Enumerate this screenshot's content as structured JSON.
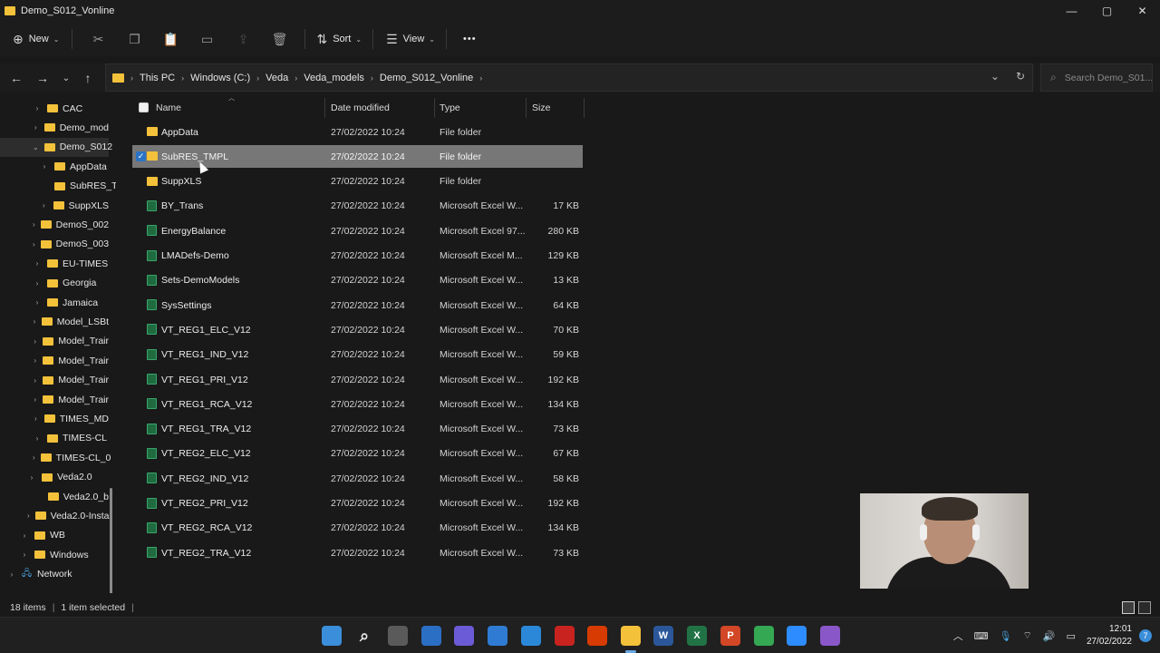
{
  "window": {
    "title": "Demo_S012_Vonline",
    "minimize": "—",
    "maximize": "▢",
    "close": "✕"
  },
  "commandbar": {
    "new_label": "New",
    "sort_label": "Sort",
    "view_label": "View",
    "more_label": "•••"
  },
  "address": {
    "crumbs": [
      "This PC",
      "Windows (C:)",
      "Veda",
      "Veda_models",
      "Demo_S012_Vonline"
    ],
    "search_placeholder": "Search Demo_S01..."
  },
  "sidebar": {
    "items": [
      {
        "label": "CAC",
        "expandable": true
      },
      {
        "label": "Demo_mod",
        "expandable": true
      },
      {
        "label": "Demo_S012",
        "expandable": true,
        "expanded": true,
        "selected": true
      },
      {
        "label": "AppData",
        "expandable": true
      },
      {
        "label": "SubRES_TI",
        "expandable": false
      },
      {
        "label": "SuppXLS",
        "expandable": true
      },
      {
        "label": "DemoS_002",
        "expandable": true
      },
      {
        "label": "DemoS_003",
        "expandable": true
      },
      {
        "label": "EU-TIMES",
        "expandable": true
      },
      {
        "label": "Georgia",
        "expandable": true
      },
      {
        "label": "Jamaica",
        "expandable": true
      },
      {
        "label": "Model_LSBt",
        "expandable": true
      },
      {
        "label": "Model_Trair",
        "expandable": true
      },
      {
        "label": "Model_Trair",
        "expandable": true
      },
      {
        "label": "Model_Trair",
        "expandable": true
      },
      {
        "label": "Model_Trair",
        "expandable": true
      },
      {
        "label": "TIMES_MD",
        "expandable": true
      },
      {
        "label": "TIMES-CL",
        "expandable": true
      },
      {
        "label": "TIMES-CL_0",
        "expandable": true
      },
      {
        "label": "Veda2.0",
        "expandable": true
      },
      {
        "label": "Veda2.0_b",
        "expandable": false
      },
      {
        "label": "Veda2.0-Insta",
        "expandable": true
      },
      {
        "label": "WB",
        "expandable": true
      },
      {
        "label": "Windows",
        "expandable": true
      },
      {
        "label": "Network",
        "expandable": true
      }
    ]
  },
  "columns": {
    "name": "Name",
    "date": "Date modified",
    "type": "Type",
    "size": "Size"
  },
  "files": [
    {
      "name": "AppData",
      "date": "27/02/2022 10:24",
      "type": "File folder",
      "size": "",
      "kind": "folder"
    },
    {
      "name": "SubRES_TMPL",
      "date": "27/02/2022 10:24",
      "type": "File folder",
      "size": "",
      "kind": "folder",
      "selected": true
    },
    {
      "name": "SuppXLS",
      "date": "27/02/2022 10:24",
      "type": "File folder",
      "size": "",
      "kind": "folder"
    },
    {
      "name": "BY_Trans",
      "date": "27/02/2022 10:24",
      "type": "Microsoft Excel W...",
      "size": "17 KB",
      "kind": "excel"
    },
    {
      "name": "EnergyBalance",
      "date": "27/02/2022 10:24",
      "type": "Microsoft Excel 97...",
      "size": "280 KB",
      "kind": "excel"
    },
    {
      "name": "LMADefs-Demo",
      "date": "27/02/2022 10:24",
      "type": "Microsoft Excel M...",
      "size": "129 KB",
      "kind": "excel"
    },
    {
      "name": "Sets-DemoModels",
      "date": "27/02/2022 10:24",
      "type": "Microsoft Excel W...",
      "size": "13 KB",
      "kind": "excel"
    },
    {
      "name": "SysSettings",
      "date": "27/02/2022 10:24",
      "type": "Microsoft Excel W...",
      "size": "64 KB",
      "kind": "excel"
    },
    {
      "name": "VT_REG1_ELC_V12",
      "date": "27/02/2022 10:24",
      "type": "Microsoft Excel W...",
      "size": "70 KB",
      "kind": "excel"
    },
    {
      "name": "VT_REG1_IND_V12",
      "date": "27/02/2022 10:24",
      "type": "Microsoft Excel W...",
      "size": "59 KB",
      "kind": "excel"
    },
    {
      "name": "VT_REG1_PRI_V12",
      "date": "27/02/2022 10:24",
      "type": "Microsoft Excel W...",
      "size": "192 KB",
      "kind": "excel"
    },
    {
      "name": "VT_REG1_RCA_V12",
      "date": "27/02/2022 10:24",
      "type": "Microsoft Excel W...",
      "size": "134 KB",
      "kind": "excel"
    },
    {
      "name": "VT_REG1_TRA_V12",
      "date": "27/02/2022 10:24",
      "type": "Microsoft Excel W...",
      "size": "73 KB",
      "kind": "excel"
    },
    {
      "name": "VT_REG2_ELC_V12",
      "date": "27/02/2022 10:24",
      "type": "Microsoft Excel W...",
      "size": "67 KB",
      "kind": "excel"
    },
    {
      "name": "VT_REG2_IND_V12",
      "date": "27/02/2022 10:24",
      "type": "Microsoft Excel W...",
      "size": "58 KB",
      "kind": "excel"
    },
    {
      "name": "VT_REG2_PRI_V12",
      "date": "27/02/2022 10:24",
      "type": "Microsoft Excel W...",
      "size": "192 KB",
      "kind": "excel"
    },
    {
      "name": "VT_REG2_RCA_V12",
      "date": "27/02/2022 10:24",
      "type": "Microsoft Excel W...",
      "size": "134 KB",
      "kind": "excel"
    },
    {
      "name": "VT_REG2_TRA_V12",
      "date": "27/02/2022 10:24",
      "type": "Microsoft Excel W...",
      "size": "73 KB",
      "kind": "excel"
    }
  ],
  "status": {
    "items_count": "18 items",
    "selected_count": "1 item selected"
  },
  "taskbar": {
    "icons": [
      {
        "name": "windows-start-icon",
        "glyph": "",
        "color": "#3b8ed9"
      },
      {
        "name": "search-icon",
        "glyph": "⌕",
        "color": "#202020"
      },
      {
        "name": "task-view-icon",
        "glyph": "",
        "color": "#5a5a5a"
      },
      {
        "name": "widgets-icon",
        "glyph": "",
        "color": "#2b6fc4"
      },
      {
        "name": "teams-chat-icon",
        "glyph": "",
        "color": "#6b5bd6"
      },
      {
        "name": "store-icon",
        "glyph": "",
        "color": "#2f7bd3"
      },
      {
        "name": "mail-icon",
        "glyph": "",
        "color": "#2b88d8"
      },
      {
        "name": "acrobat-icon",
        "glyph": "",
        "color": "#c8231f"
      },
      {
        "name": "office-icon",
        "glyph": "",
        "color": "#d83b01"
      },
      {
        "name": "file-explorer-icon",
        "glyph": "",
        "color": "#f3c13a"
      },
      {
        "name": "word-icon",
        "glyph": "W",
        "color": "#2b579a"
      },
      {
        "name": "excel-icon",
        "glyph": "X",
        "color": "#217346"
      },
      {
        "name": "powerpoint-icon",
        "glyph": "P",
        "color": "#d24726"
      },
      {
        "name": "chrome-icon",
        "glyph": "",
        "color": "#34a853"
      },
      {
        "name": "zoom-icon",
        "glyph": "",
        "color": "#2d8cff"
      },
      {
        "name": "github-icon",
        "glyph": "",
        "color": "#8a57c9"
      }
    ],
    "time": "12:01",
    "date": "27/02/2022",
    "notification_count": "7"
  }
}
